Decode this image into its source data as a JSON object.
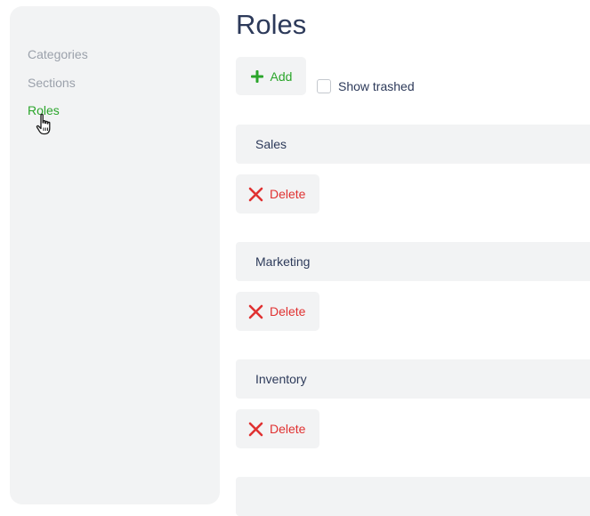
{
  "sidebar": {
    "items": [
      {
        "label": "Categories"
      },
      {
        "label": "Sections"
      },
      {
        "label": "Roles"
      }
    ]
  },
  "page": {
    "title": "Roles"
  },
  "toolbar": {
    "add_label": "Add",
    "show_trashed_label": "Show trashed",
    "show_trashed_checked": false
  },
  "roles": [
    {
      "name": "Sales",
      "delete_label": "Delete"
    },
    {
      "name": "Marketing",
      "delete_label": "Delete"
    },
    {
      "name": "Inventory",
      "delete_label": "Delete"
    }
  ],
  "colors": {
    "accent": "#2aa52a",
    "danger": "#e03131",
    "text": "#2d3a5a",
    "muted": "#9ba1ab",
    "panel": "#f2f3f4"
  },
  "icons": {
    "add": "plus-icon",
    "delete": "x-icon",
    "cursor": "hand-pointer-icon"
  }
}
